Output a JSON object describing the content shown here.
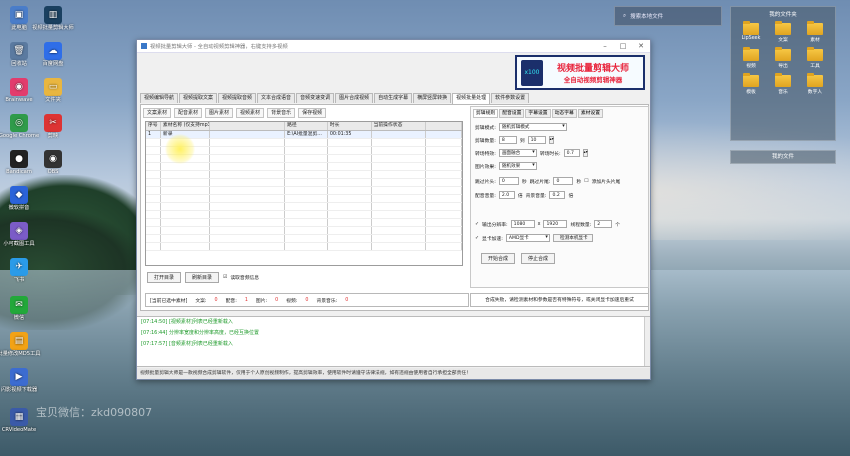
{
  "desktop": {
    "icons_left": [
      {
        "label": "此电脑",
        "color": "#4a7dc9",
        "glyph": "▣"
      },
      {
        "label": "回收站",
        "color": "#5b7aa0",
        "glyph": "🗑"
      },
      {
        "label": "Brainwave",
        "color": "#e23c6d",
        "glyph": "◉"
      },
      {
        "label": "Google Chrome",
        "color": "#2f9b4a",
        "glyph": "◎"
      },
      {
        "label": "Bandicam",
        "color": "#222222",
        "glyph": "●"
      },
      {
        "label": "微软拼音",
        "color": "#2b63d9",
        "glyph": "◆"
      },
      {
        "label": "小可截图工具",
        "color": "#7b5cc7",
        "glyph": "◈"
      },
      {
        "label": "飞书",
        "color": "#2a9be8",
        "glyph": "✈"
      },
      {
        "label": "微信",
        "color": "#22a83a",
        "glyph": "✉"
      },
      {
        "label": "批量修改MD5工具",
        "color": "#f2a216",
        "glyph": "▤"
      },
      {
        "label": "闪影视频下载器",
        "color": "#3c6cd0",
        "glyph": "▶"
      },
      {
        "label": "CRVideoMate",
        "color": "#3a5aa8",
        "glyph": "▦"
      }
    ],
    "icons_col2": [
      {
        "label": "视频批量剪辑大师",
        "color": "#1a4060",
        "glyph": "▥"
      },
      {
        "label": "百度网盘",
        "color": "#2f6ee8",
        "glyph": "☁"
      },
      {
        "label": "文件夹",
        "color": "#e9b640",
        "glyph": "▭"
      },
      {
        "label": "剪映",
        "color": "#d33",
        "glyph": "✂"
      },
      {
        "label": "OBS",
        "color": "#333",
        "glyph": "◉"
      }
    ],
    "watermark": "宝贝微信：zkd090807",
    "search_widget": "搜索本地文件",
    "files_widget": {
      "title": "我的文件夹",
      "folders": [
        "LipSeek",
        "文案",
        "素材",
        "视频",
        "导出",
        "工具",
        "模板",
        "音乐",
        "数字人"
      ]
    },
    "files_widget2": "我的文件"
  },
  "app": {
    "title": "视频批量剪辑大师 - 全自动视频剪辑神器，右键支持多视频",
    "banner": {
      "badge": "x100",
      "title": "视频批量剪辑大师",
      "subtitle": "全自动视频剪辑神器"
    },
    "tabs": [
      "视频编辑导航",
      "视频提取文案",
      "视频提取音频",
      "文本合成语音",
      "音频变速变调",
      "图片合成视频",
      "自动生成字幕",
      "横屏竖屏转换",
      "视频批量处理",
      "软件参数设置"
    ],
    "active_tab": 8,
    "toolbar": [
      "文案素材",
      "配音素材",
      "图片素材",
      "视频素材",
      "背景音乐",
      "保存视频"
    ],
    "grid": {
      "headers": [
        "序号",
        "素材名称 (仅支持mp3格式)",
        "",
        "路径",
        "时长",
        "当前操作状态",
        ""
      ],
      "rows": [
        [
          "1",
          "新录",
          "",
          "E:\\AI批量混剪...",
          "00:01:35",
          "",
          ""
        ]
      ]
    },
    "buttons": {
      "open": "打开目录",
      "refresh": "刷新目录",
      "read_info": "读取音频信息"
    },
    "settings": {
      "tabs": [
        "剪辑规则",
        "配音设置",
        "字幕设置",
        "动态字幕",
        "素材设置"
      ],
      "rows": [
        {
          "label": "剪辑模式:",
          "value": "随机剪辑模式"
        },
        {
          "label": "剪辑数量:",
          "value": "8",
          "value2": "10"
        },
        {
          "label": "转场特效:",
          "value": "画面融合",
          "label2": "转场时长:",
          "value2": "0.7"
        },
        {
          "label": "图片效果:",
          "value": "随机效果"
        },
        {
          "label": "跳过片头:",
          "value": "0",
          "unit": "秒",
          "label2": "跳过片尾:",
          "value2": "0",
          "unit2": "秒",
          "check": "添加片头片尾"
        },
        {
          "label": "配音音量:",
          "value": "2.0",
          "unit": "倍",
          "label2": "背景音量:",
          "value2": "0.2",
          "unit2": "倍"
        }
      ],
      "output": {
        "label": "输出分辨率:",
        "w": "1080",
        "x": "x",
        "h": "1920",
        "thread_label": "线程数量:",
        "threads": "2",
        "unit": "个"
      },
      "gpu": {
        "label": "显卡加速:",
        "value": "AMD显卡",
        "button": "检测本机显卡"
      },
      "start": "开始合成",
      "stop": "停止合成"
    },
    "stats": {
      "label": "[当前已选中素材]",
      "items": [
        {
          "name": "文案:",
          "value": "0"
        },
        {
          "name": "配音:",
          "value": "1"
        },
        {
          "name": "图片:",
          "value": "0"
        },
        {
          "name": "视频:",
          "value": "0"
        },
        {
          "name": "背景音乐:",
          "value": "0"
        }
      ]
    },
    "notice": "合成失败，请检测素材和参数是否有特殊符号，或关闭显卡加速后重试",
    "log": [
      "[07:14:50] [视频素材]列表已经重新载入",
      "[07:16:44] 分辨率宽度和分辨率高度，已经互换位置",
      "[07:17:57] [音频素材]列表已经重新载入"
    ],
    "statusbar": "视频批量剪辑大师是一款视频合成剪辑软件，仅用于个人原创视频制作，提高剪辑效率，使用软件时请遵守法律法规，如有违规由使用者自行承担全部责任！"
  }
}
